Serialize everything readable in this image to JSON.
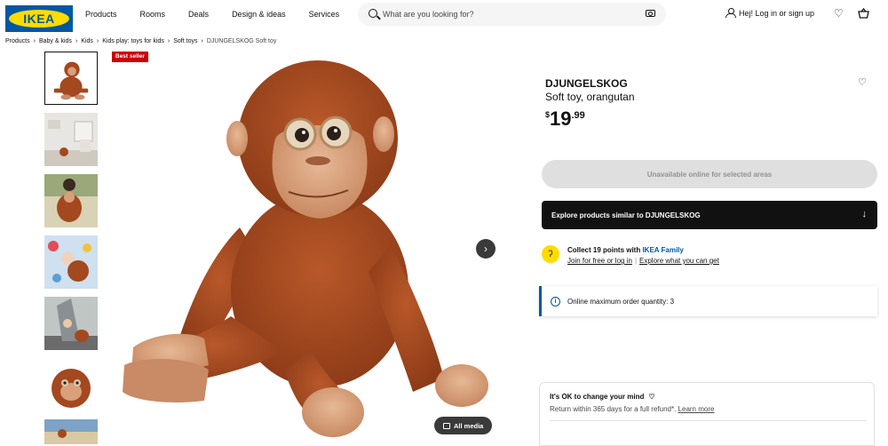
{
  "header": {
    "logo_text": "IKEA",
    "nav": [
      "Products",
      "Rooms",
      "Deals",
      "Design & ideas",
      "Services"
    ],
    "search_placeholder": "What are you looking for?",
    "login_label": "Hej! Log in or sign up",
    "icons": {
      "search": "search-icon",
      "camera": "camera-icon",
      "person": "person-icon",
      "wishlist": "heart-icon",
      "cart": "shopping-bag-icon"
    }
  },
  "breadcrumb": [
    "Products",
    "Baby & kids",
    "Kids",
    "Kids play: toys for kids",
    "Soft toys",
    "DJUNGELSKOG Soft toy"
  ],
  "gallery": {
    "badge": "Best seller",
    "all_media_label": "All media",
    "thumbnail_count": 7,
    "selected_thumbnail": 1
  },
  "product": {
    "name": "DJUNGELSKOG",
    "description": "Soft toy, orangutan",
    "price_currency": "$",
    "price_integer": "19",
    "price_decimal": ".99"
  },
  "actions": {
    "unavailable_label": "Unavailable online for selected areas",
    "explore_label": "Explore products similar to DJUNGELSKOG"
  },
  "family": {
    "title_prefix": "Collect 19 points with ",
    "title_link": "IKEA Family",
    "join_link": "Join for free or log in",
    "separator": "|",
    "explore_link": "Explore what you can get"
  },
  "info": {
    "max_quantity_text": "Online maximum order quantity: 3"
  },
  "change_mind": {
    "title": "It's OK to change your mind",
    "text": "Return within 365 days for a full refund*.",
    "link": "Learn more"
  },
  "colors": {
    "ikea_blue": "#0058a3",
    "ikea_yellow": "#ffdb00",
    "badge_red": "#cc0008",
    "orangutan_fur": "#a4481f"
  }
}
